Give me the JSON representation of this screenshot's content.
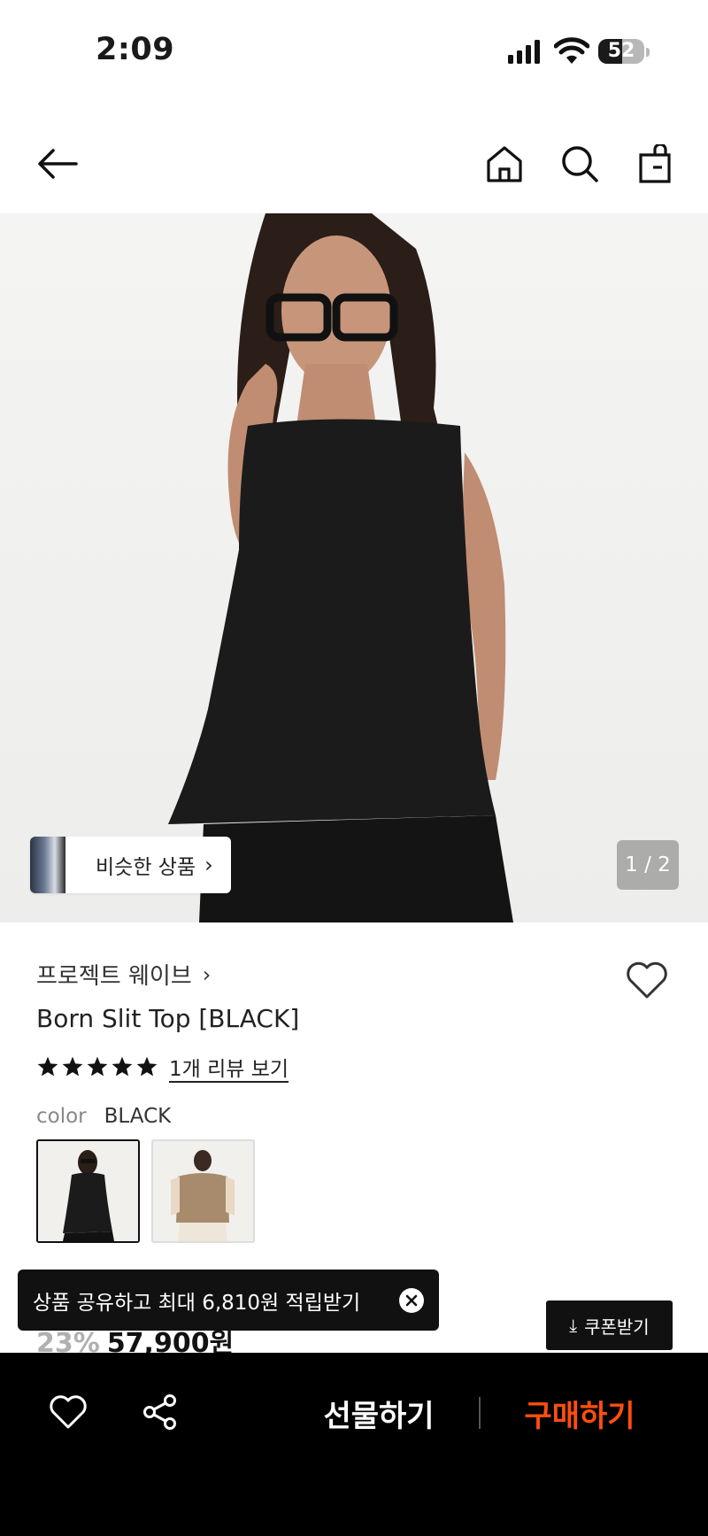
{
  "status_bar": {
    "time": "2:09",
    "battery_level": "52",
    "battery_fraction": 0.52
  },
  "nav": {
    "back_icon": "arrow-left-icon",
    "home_icon": "home-icon",
    "search_icon": "search-icon",
    "bag_icon": "shopping-bag-icon"
  },
  "gallery": {
    "similar_products_label": "비슷한 상품",
    "page_indicator": "1 / 2",
    "current_page": 1,
    "total_pages": 2
  },
  "product": {
    "brand": "프로젝트 웨이브",
    "title": "Born Slit Top [BLACK]",
    "rating_stars": 5,
    "review_link": "1개 리뷰 보기",
    "color_label": "color",
    "color_value": "BLACK",
    "swatches": [
      {
        "name": "black",
        "selected": true
      },
      {
        "name": "beige",
        "selected": false
      }
    ],
    "discount": "23%",
    "price": "57,900원"
  },
  "toast": {
    "message": "상품 공유하고 최대 6,810원 적립받기"
  },
  "coupon": {
    "label": "쿠폰받기"
  },
  "bottom_bar": {
    "gift_label": "선물하기",
    "buy_label": "구매하기"
  },
  "colors": {
    "accent": "#ff4e0f",
    "toast_bg": "#111111",
    "bottom_bar_bg": "#000000"
  }
}
